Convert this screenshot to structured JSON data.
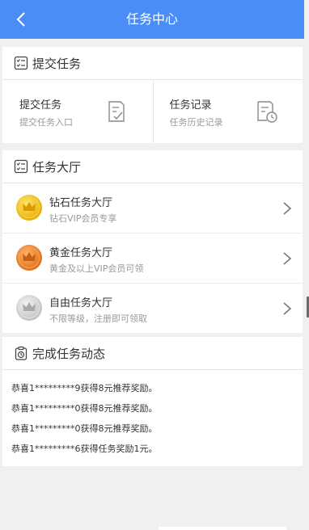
{
  "header": {
    "title": "任务中心",
    "back_icon": "chevron-left-icon"
  },
  "submit_section": {
    "title": "提交任务",
    "icon": "checklist-icon",
    "cells": [
      {
        "label": "提交任务",
        "sub": "提交任务入口",
        "icon": "edit-document-icon"
      },
      {
        "label": "任务记录",
        "sub": "任务历史记录",
        "icon": "history-document-icon"
      }
    ]
  },
  "hall_section": {
    "title": "任务大厅",
    "icon": "checklist-icon",
    "items": [
      {
        "label": "钻石任务大厅",
        "sub": "钻石VIP会员专享",
        "medal": "gold-crown-medal",
        "color": "#f5c518"
      },
      {
        "label": "黄金任务大厅",
        "sub": "黄金及以上VIP会员可领",
        "medal": "orange-crown-medal",
        "color": "#f08a2c"
      },
      {
        "label": "自由任务大厅",
        "sub": "不限等级，注册即可领取",
        "medal": "silver-crown-medal",
        "color": "#cfcfcf"
      }
    ]
  },
  "feed_section": {
    "title": "完成任务动态",
    "icon": "clipboard-clock-icon",
    "items": [
      "恭喜1*********9获得8元推荐奖励。",
      "恭喜1*********0获得8元推荐奖励。",
      "恭喜1*********0获得8元推荐奖励。",
      "恭喜1*********6获得任务奖励1元。"
    ]
  },
  "colors": {
    "header_bg": "#4a8df6",
    "page_bg": "#f0f0f0"
  }
}
